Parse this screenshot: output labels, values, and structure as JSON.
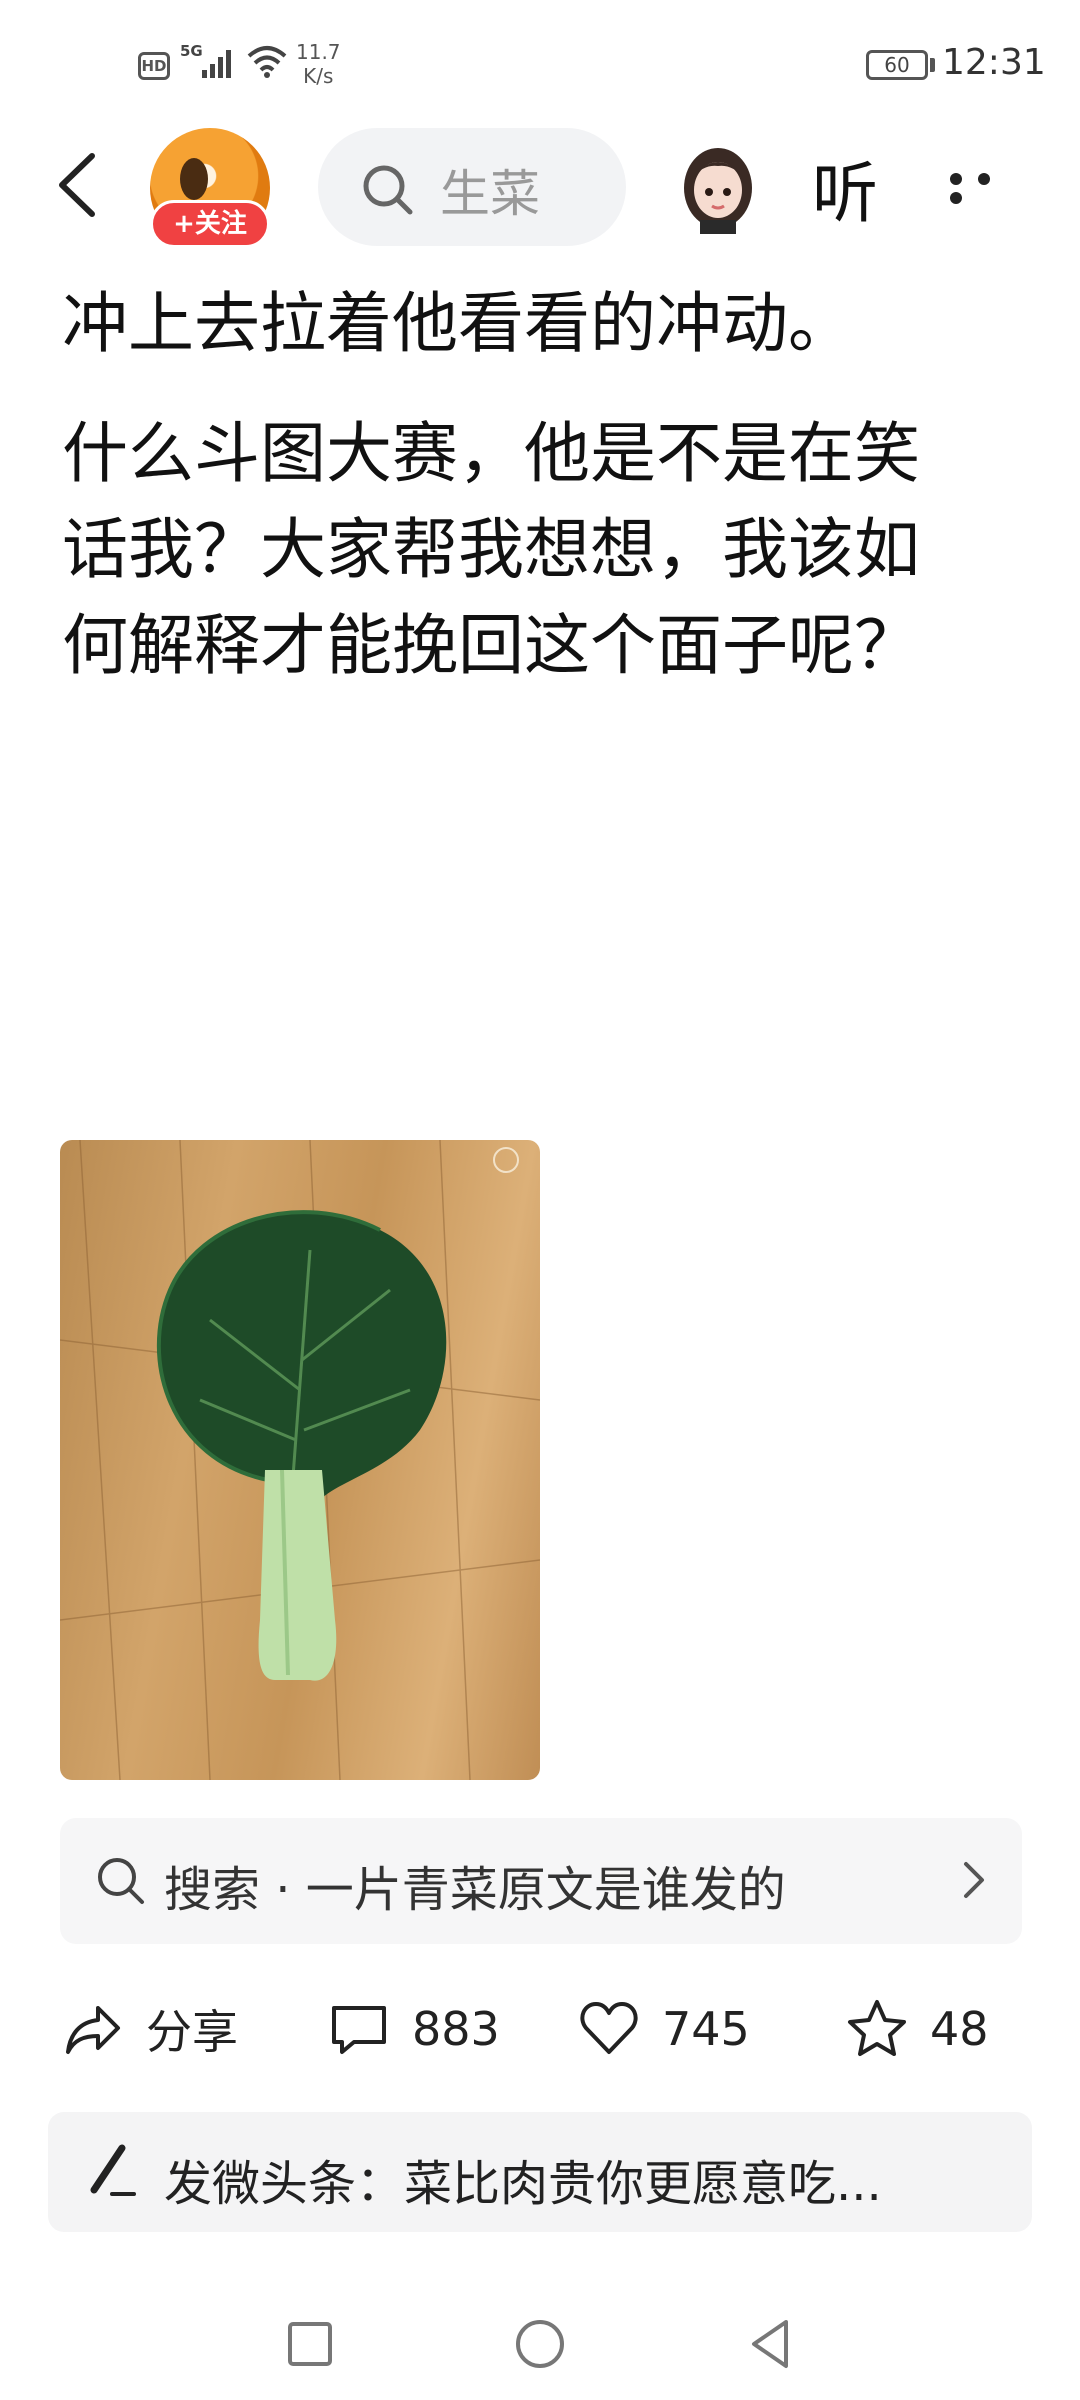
{
  "status_bar": {
    "hd": "HD",
    "network": "5G",
    "speed_value": "11.7",
    "speed_unit": "K/s",
    "battery": "60",
    "time": "12:31"
  },
  "top_bar": {
    "follow_label": "+关注",
    "search_text": "生菜",
    "listen_label": "听"
  },
  "article": {
    "paragraphs": [
      "冲上去拉着他看看的冲动。",
      "什么斗图大赛，他是不是在笑话我？大家帮我想想，我该如何解释才能挽回这个面子呢？"
    ]
  },
  "search_suggestion": {
    "text": "搜索 · 一片青菜原文是谁发的"
  },
  "actions": {
    "share_label": "分享",
    "comments_count": "883",
    "likes_count": "745",
    "favorites_count": "48"
  },
  "compose": {
    "text": "发微头条：菜比肉贵你更愿意吃..."
  },
  "colors": {
    "follow_red": "#f04142",
    "search_bg": "#f2f3f5"
  }
}
